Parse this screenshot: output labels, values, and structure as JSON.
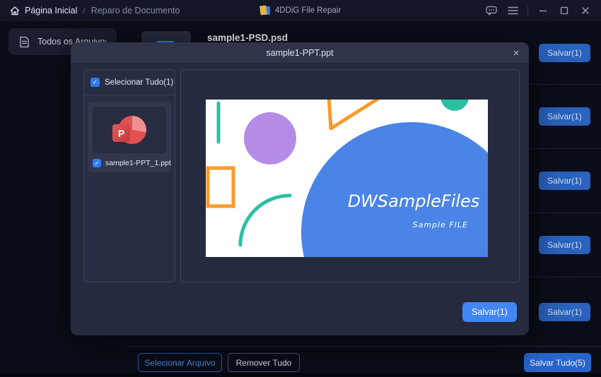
{
  "titlebar": {
    "home_label": "Página Inicial",
    "separator": "/",
    "section_label": "Reparo de Documento",
    "app_name": "4DDiG File Repair"
  },
  "sidebar": {
    "all_files_label": "Todos os Arquivos"
  },
  "file_list": {
    "rows": [
      {
        "name": "sample1-PSD.psd",
        "save_label": "Salvar(1)"
      },
      {
        "save_label": "Salvar(1)"
      },
      {
        "save_label": "Salvar(1)"
      },
      {
        "save_label": "Salvar(1)"
      },
      {
        "save_label": "Salvar(1)"
      }
    ]
  },
  "footer": {
    "select_file_label": "Selecionar Arquivo",
    "remove_all_label": "Remover Tudo",
    "save_all_label": "Salvar Tudo(5)"
  },
  "modal": {
    "title": "sample1-PPT.ppt",
    "select_all_label": "Selecionar Tudo(1)",
    "file_item": {
      "name": "sample1-PPT_1.ppt",
      "icon_letter": "P"
    },
    "save_label": "Salvar(1)",
    "slide": {
      "title": "DWSampleFiles",
      "subtitle": "Sample FILE"
    }
  },
  "icons": {
    "check": "✓",
    "modal_close": "×"
  },
  "colors": {
    "accent_blue": "#4285f4",
    "dim_button_blue": "#2a62bd",
    "checkbox_blue": "#2e7bf5",
    "slide_blue": "#4a84e6",
    "slide_purple": "#b48ce8",
    "slide_orange": "#f89b2d",
    "slide_teal": "#2bbfa4",
    "ppt_red": "#e25151"
  }
}
